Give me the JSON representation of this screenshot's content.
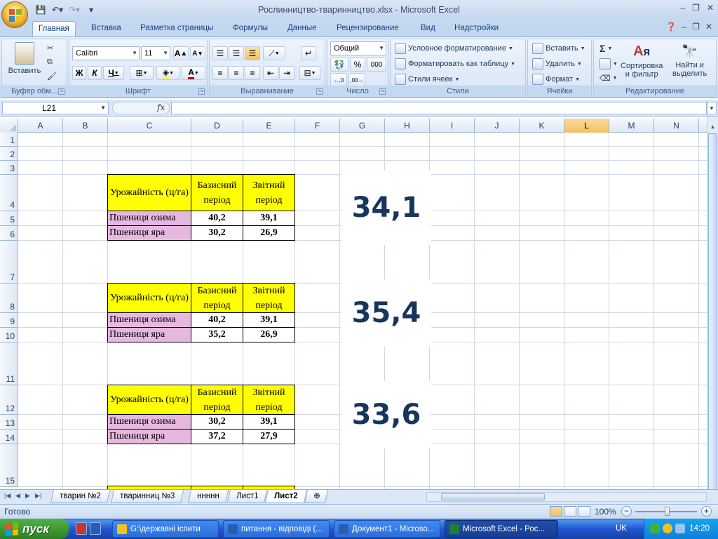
{
  "window": {
    "title": "Рослинництво-тваринництво.xlsx - Microsoft Excel",
    "controls": [
      "–",
      "❐",
      "✕"
    ]
  },
  "ribbon_tabs": [
    "Главная",
    "Вставка",
    "Разметка страницы",
    "Формулы",
    "Данные",
    "Рецензирование",
    "Вид",
    "Надстройки"
  ],
  "active_tab": "Главная",
  "ribbon": {
    "clipboard": {
      "group": "Буфер обм...",
      "paste": "Вставить"
    },
    "font": {
      "group": "Шрифт",
      "font_name": "Calibri",
      "font_size": "11",
      "bold": "Ж",
      "italic": "К",
      "underline": "Ч",
      "grow": "A",
      "shrink": "A",
      "font_color_letter": "A"
    },
    "alignment": {
      "group": "Выравнивание"
    },
    "number": {
      "group": "Число",
      "format": "Общий",
      "percent": "%",
      "thousands": "000"
    },
    "styles": {
      "group": "Стили",
      "conditional": "Условное форматирование",
      "as_table": "Форматировать как таблицу",
      "cell_styles": "Стили ячеек"
    },
    "cells": {
      "group": "Ячейки",
      "insert": "Вставить",
      "delete": "Удалить",
      "format": "Формат"
    },
    "editing": {
      "group": "Редактирование",
      "sigma": "Σ",
      "sort": "Сортировка\nи фильтр",
      "find": "Найти и\nвыделить"
    }
  },
  "formula_bar": {
    "name_box": "L21",
    "fx": "fx",
    "value": ""
  },
  "columns": [
    "A",
    "B",
    "C",
    "D",
    "E",
    "F",
    "G",
    "H",
    "I",
    "J",
    "K",
    "L",
    "M",
    "N"
  ],
  "selected_column": "L",
  "rows": [
    "1",
    "2",
    "3",
    "4",
    "5",
    "6",
    "7",
    "8",
    "9",
    "10",
    "11",
    "12",
    "13",
    "14",
    "15"
  ],
  "tables": [
    {
      "header": [
        "Урожайність (ц/га)",
        "Базисний період",
        "Звітний період"
      ],
      "rows": [
        [
          "Пшениця озима",
          "40,2",
          "39,1"
        ],
        [
          "Пшениця яра",
          "30,2",
          "26,9"
        ]
      ],
      "result": "34,1"
    },
    {
      "header": [
        "Урожайність (ц/га)",
        "Базисний період",
        "Звітний період"
      ],
      "rows": [
        [
          "Пшениця озима",
          "40,2",
          "39,1"
        ],
        [
          "Пшениця яра",
          "35,2",
          "26,9"
        ]
      ],
      "result": "35,4"
    },
    {
      "header": [
        "Урожайність (ц/га)",
        "Базисний період",
        "Звітний період"
      ],
      "rows": [
        [
          "Пшениця озима",
          "30,2",
          "39,1"
        ],
        [
          "Пшениця яра",
          "37,2",
          "27,9"
        ]
      ],
      "result": "33,6"
    }
  ],
  "sheet_tabs": [
    "тварин №2",
    "тваринниц №3",
    "ннннн",
    "Лист1",
    "Лист2"
  ],
  "active_sheet": "Лист2",
  "status": {
    "ready": "Готово",
    "zoom": "100%"
  },
  "taskbar": {
    "start": "пуск",
    "tasks": [
      "G:\\державні іспити",
      "питання - відповіді (...",
      "Документ1 - Microso...",
      "Microsoft Excel - Рос..."
    ],
    "language": "UK",
    "clock": "14:20"
  },
  "colors": {
    "header_fill": "#ffff00",
    "name_fill": "#e6b8e0",
    "result_text": "#17365d"
  }
}
